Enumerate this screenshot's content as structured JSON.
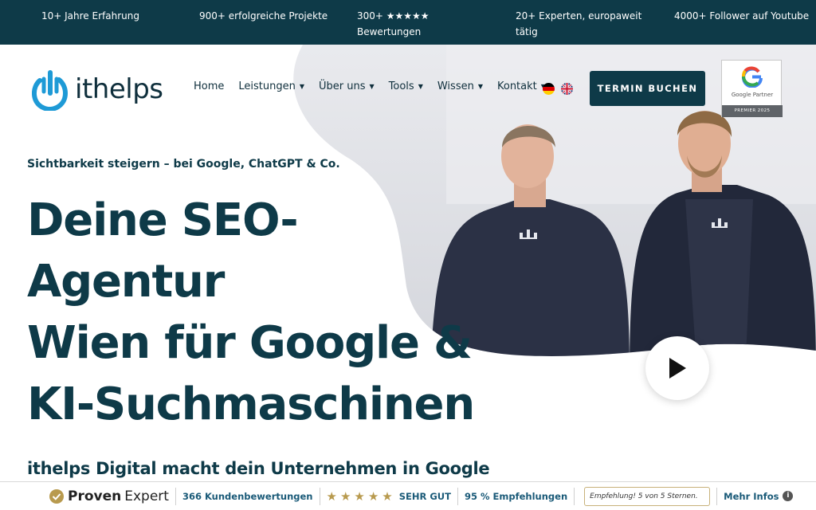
{
  "topbar": {
    "stats": [
      "10+ Jahre Erfahrung",
      "900+ erfolgreiche Projekte",
      "300+ ★★★★★ Bewertungen",
      "20+ Experten, europaweit tätig",
      "4000+ Follower auf Youtube"
    ]
  },
  "header": {
    "logo_text": "ithelps",
    "logo_icon": "power-hand-icon",
    "nav": [
      {
        "label": "Home",
        "dropdown": false
      },
      {
        "label": "Leistungen",
        "dropdown": true
      },
      {
        "label": "Über uns",
        "dropdown": true
      },
      {
        "label": "Tools",
        "dropdown": true
      },
      {
        "label": "Wissen",
        "dropdown": true
      },
      {
        "label": "Kontakt",
        "dropdown": true
      }
    ],
    "languages": [
      "de-flag-icon",
      "uk-flag-icon"
    ],
    "cta_label": "TERMIN BUCHEN",
    "badge": {
      "title": "Google Partner",
      "subtitle": "PREMIER 2025"
    }
  },
  "hero": {
    "subline": "Sichtbarkeit steigern – bei Google, ChatGPT & Co.",
    "headline_lines": [
      "Deine SEO-",
      "Agentur",
      "Wien für Google &",
      "KI-Suchmaschinen"
    ],
    "intro": "ithelps Digital macht dein Unternehmen in Google",
    "play_icon": "play-icon"
  },
  "provenexpert": {
    "brand_a": "Proven",
    "brand_b": "Expert",
    "reviews": "366 Kundenbewertungen",
    "stars": "★★★★★",
    "rating_text": "SEHR GUT",
    "recommend": "95 % Empfehlungen",
    "quote": "Empfehlung! 5 von 5 Sternen.",
    "more": "Mehr Infos"
  },
  "colors": {
    "brand_dark": "#0e3a48",
    "logo_blue": "#1e9ad6",
    "star_gold": "#b89a4e"
  }
}
